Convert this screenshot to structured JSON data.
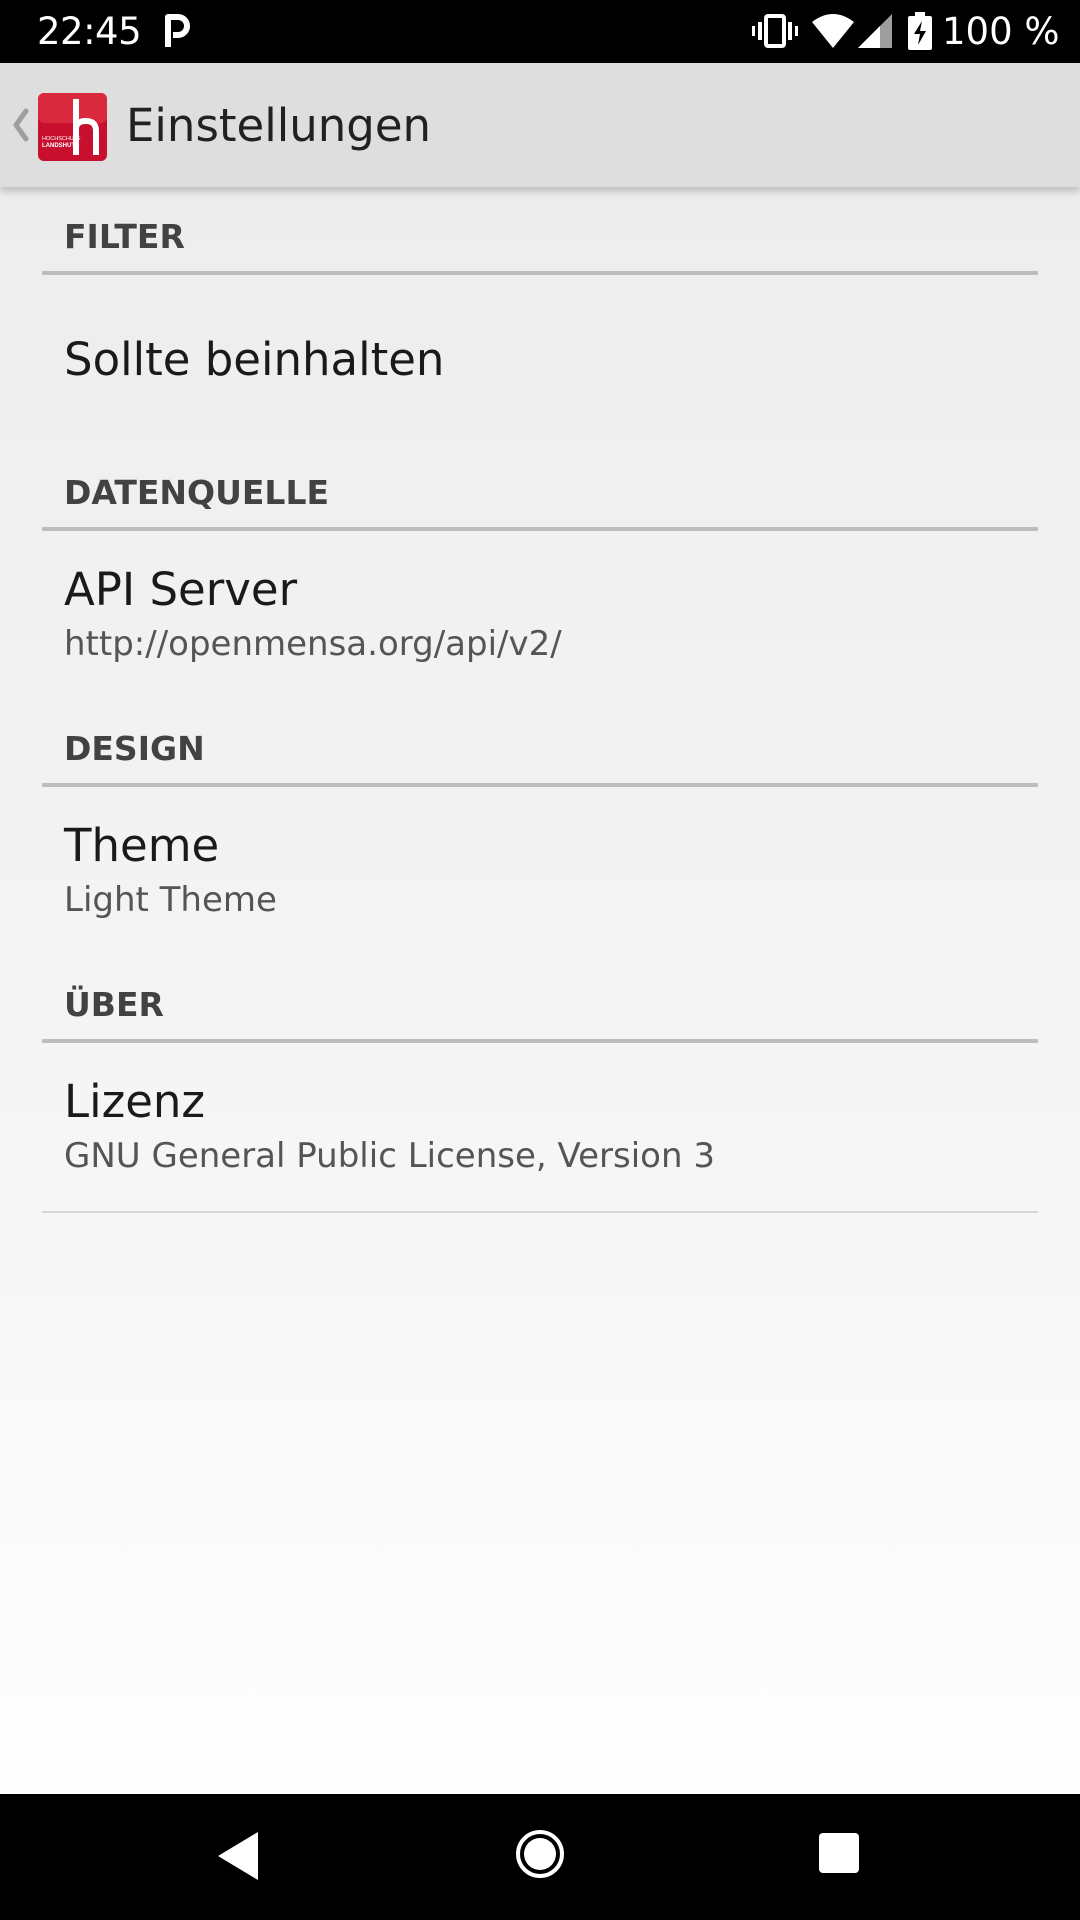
{
  "status_bar": {
    "time": "22:45",
    "battery": "100 %",
    "icons": [
      "parking-icon",
      "vibrate-icon",
      "wifi-icon",
      "signal-icon",
      "battery-charging-icon"
    ]
  },
  "action_bar": {
    "title": "Einstellungen",
    "logo_text_line1": "HOCHSCHULE",
    "logo_text_line2": "LANDSHUT",
    "icons": [
      "back-chevron-icon",
      "app-logo"
    ],
    "colors": {
      "logo_red": "#c8102e",
      "background": "#dedede"
    }
  },
  "preferences": {
    "filter": {
      "category": "FILTER",
      "item_title": "Sollte beinhalten"
    },
    "datenquelle": {
      "category": "DATENQUELLE",
      "item_title": "API Server",
      "item_summary": "http://openmensa.org/api/v2/"
    },
    "design": {
      "category": "DESIGN",
      "item_title": "Theme",
      "item_summary": "Light Theme"
    },
    "ueber": {
      "category": "ÜBER",
      "item_title": "Lizenz",
      "item_summary": "GNU General Public License, Version 3"
    }
  },
  "nav_bar": {
    "icons": [
      "nav-back-icon",
      "nav-home-icon",
      "nav-recents-icon"
    ]
  }
}
